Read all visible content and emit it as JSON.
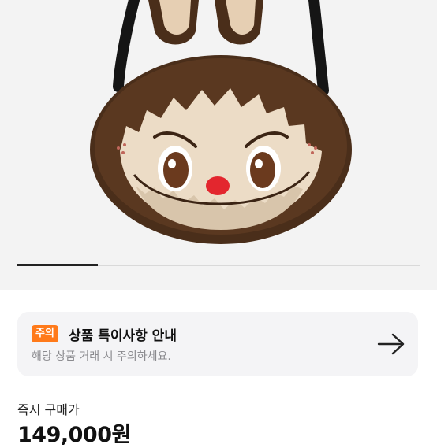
{
  "product": {
    "image_icon": "labubu-plush-bag-image"
  },
  "gallery": {
    "active_index": 1,
    "total_slides": 5
  },
  "notice": {
    "badge": "주의",
    "title": "상품 특이사항 안내",
    "subtitle": "해당 상품 거래 시 주의하세요.",
    "arrow_icon": "arrow-right-icon",
    "badge_color": "#ff7a1a"
  },
  "price": {
    "label": "즉시 구매가",
    "value": "149,000원"
  }
}
